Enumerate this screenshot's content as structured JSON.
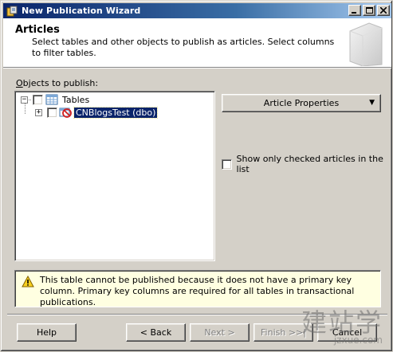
{
  "window": {
    "title": "New Publication Wizard",
    "minimize_icon": "minimize-icon",
    "maximize_icon": "maximize-icon",
    "close_icon": "close-icon"
  },
  "header": {
    "title": "Articles",
    "description": "Select tables and other objects to publish as articles. Select columns to filter tables."
  },
  "objects": {
    "label_prefix": "O",
    "label_rest": "bjects to publish:",
    "tree": [
      {
        "label": "Tables",
        "expander": "−",
        "icon": "table-icon"
      },
      {
        "label": "CNBlogsTest (dbo)",
        "expander": "+",
        "icon": "blocked-table-icon",
        "selected": true
      }
    ]
  },
  "article_properties": {
    "label": "Article Properties",
    "arrow": "▼"
  },
  "show_only_checked": {
    "label": "Show only checked articles in the list",
    "checked": false
  },
  "warning": {
    "icon": "warning-icon",
    "text": "This table cannot be published because it does not have a primary key column. Primary key columns are required for all tables in transactional publications."
  },
  "footer": {
    "help": "Help",
    "back": "< Back",
    "next": "Next >",
    "finish": "Finish >>|",
    "cancel": "Cancel"
  },
  "watermark": {
    "line1": "建站学",
    "line2": "jzxue.com"
  }
}
